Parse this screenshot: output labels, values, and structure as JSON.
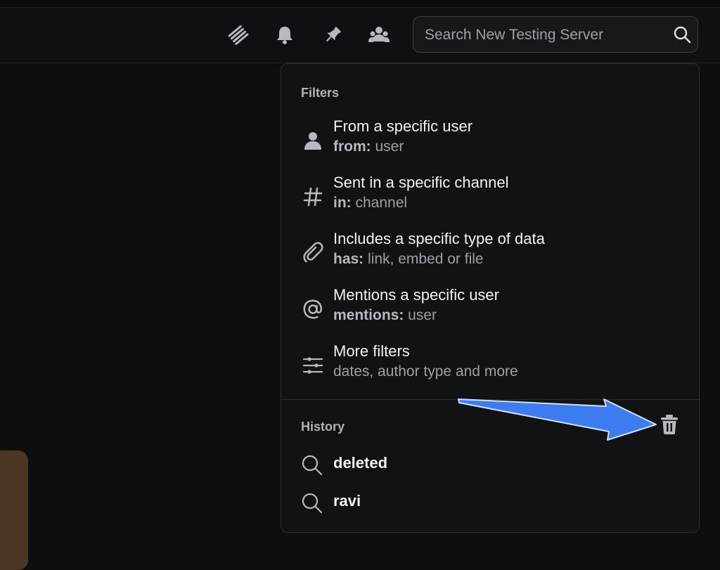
{
  "header": {
    "icons": [
      "threads-icon",
      "notification-bell-icon",
      "pinned-messages-icon",
      "member-list-icon"
    ],
    "search": {
      "placeholder": "Search New Testing Server",
      "icon": "search-icon"
    }
  },
  "popup": {
    "filters_title": "Filters",
    "filters": [
      {
        "icon": "user-icon",
        "title": "From a specific user",
        "key": "from:",
        "value": " user"
      },
      {
        "icon": "hash-icon",
        "title": "Sent in a specific channel",
        "key": "in:",
        "value": " channel"
      },
      {
        "icon": "paperclip-icon",
        "title": "Includes a specific type of data",
        "key": "has:",
        "value": " link, embed or file"
      },
      {
        "icon": "at-icon",
        "title": "Mentions a specific user",
        "key": "mentions:",
        "value": " user"
      },
      {
        "icon": "sliders-icon",
        "title": "More filters",
        "key": "",
        "value": "dates, author type and more"
      }
    ],
    "history_title": "History",
    "history": [
      {
        "text": "deleted"
      },
      {
        "text": "ravi"
      }
    ],
    "clear_history_icon": "trash-icon"
  },
  "annotation": {
    "arrow_color": "#3d7bf0"
  }
}
